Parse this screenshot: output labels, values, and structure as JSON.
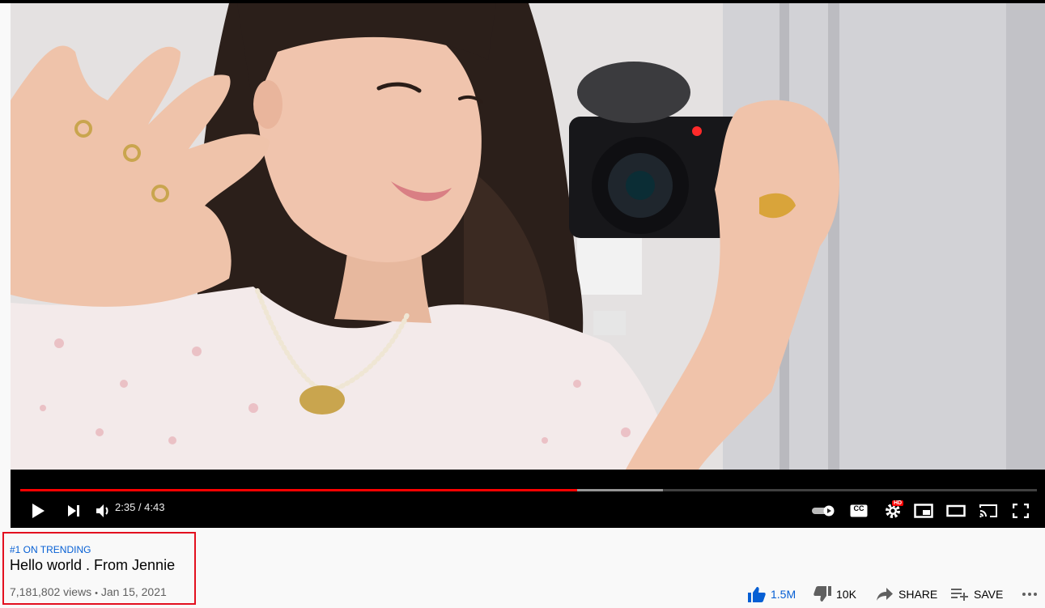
{
  "player": {
    "time_display": "2:35 / 4:43",
    "progress_fraction": 0.548,
    "buffered_fraction": 0.632,
    "buttons": {
      "play": "play-icon",
      "next": "next-icon",
      "volume": "volume-icon",
      "autoplay": "autoplay-toggle-icon",
      "captions": "CC",
      "settings_badge": "HD",
      "miniplayer": "miniplayer-icon",
      "theater": "theater-icon",
      "cast": "cast-icon",
      "fullscreen": "fullscreen-icon"
    },
    "colors": {
      "played": "#ff0000",
      "hd_badge": "#ff0000"
    }
  },
  "video_info": {
    "trending_label": "#1 ON TRENDING",
    "title": "Hello world . From Jennie",
    "views": "7,181,802 views",
    "separator": "•",
    "date": "Jan 15, 2021"
  },
  "actions": {
    "like_count": "1.5M",
    "dislike_count": "10K",
    "share_label": "SHARE",
    "save_label": "SAVE",
    "colors": {
      "like_active": "#065fd4"
    }
  }
}
